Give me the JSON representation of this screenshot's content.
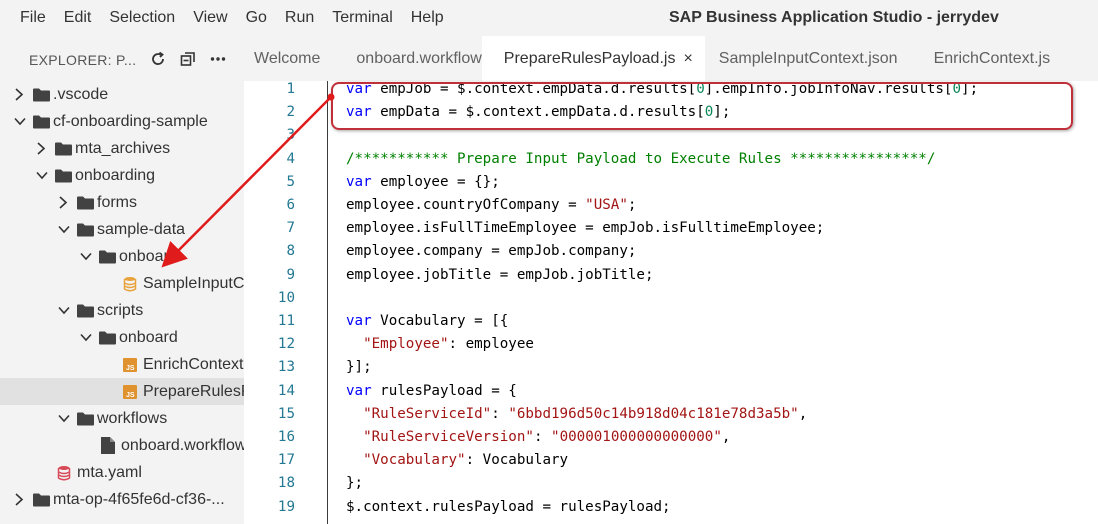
{
  "menu": [
    "File",
    "Edit",
    "Selection",
    "View",
    "Go",
    "Run",
    "Terminal",
    "Help"
  ],
  "window_title": "SAP Business Application Studio - jerrydev",
  "explorer": {
    "title": "EXPLORER: P...",
    "icons": [
      "refresh-icon",
      "collapse-all-icon",
      "more-icon"
    ]
  },
  "tree": [
    {
      "label": ".vscode",
      "icon": "folder-icon",
      "state": "collapsed"
    },
    {
      "label": "cf-onboarding-sample",
      "icon": "folder-icon",
      "state": "expanded"
    },
    {
      "label": "mta_archives",
      "icon": "folder-icon",
      "state": "collapsed"
    },
    {
      "label": "onboarding",
      "icon": "folder-icon",
      "state": "expanded"
    },
    {
      "label": "forms",
      "icon": "folder-icon",
      "state": "collapsed"
    },
    {
      "label": "sample-data",
      "icon": "folder-icon",
      "state": "expanded"
    },
    {
      "label": "onboard",
      "icon": "folder-icon",
      "state": "expanded"
    },
    {
      "label": "SampleInputCont...",
      "icon": "json-file-icon",
      "state": "file"
    },
    {
      "label": "scripts",
      "icon": "folder-icon",
      "state": "expanded"
    },
    {
      "label": "onboard",
      "icon": "folder-icon",
      "state": "expanded"
    },
    {
      "label": "EnrichContext.js",
      "icon": "js-file-icon",
      "state": "file"
    },
    {
      "label": "PrepareRulesPayl...",
      "icon": "js-file-icon",
      "state": "file",
      "selected": true
    },
    {
      "label": "workflows",
      "icon": "folder-icon",
      "state": "expanded"
    },
    {
      "label": "onboard.workflow",
      "icon": "file-icon",
      "state": "file"
    },
    {
      "label": "mta.yaml",
      "icon": "yaml-file-icon",
      "state": "file"
    },
    {
      "label": "mta-op-4f65fe6d-cf36-...",
      "icon": "folder-icon",
      "state": "collapsed"
    }
  ],
  "tabs": [
    {
      "label": "Welcome"
    },
    {
      "label": "onboard.workflow"
    },
    {
      "label": "PrepareRulesPayload.js",
      "active": true,
      "close": "×"
    },
    {
      "label": "SampleInputContext.json"
    },
    {
      "label": "EnrichContext.js"
    }
  ],
  "code_lines": [
    "var empJob = $.context.empData.d.results[0].empInfo.jobInfoNav.results[0];",
    "var empData = $.context.empData.d.results[0];",
    "",
    "/*********** Prepare Input Payload to Execute Rules ****************/",
    "var employee = {};",
    "employee.countryOfCompany = \"USA\";",
    "employee.isFullTimeEmployee = empJob.isFulltimeEmployee;",
    "employee.company = empJob.company;",
    "employee.jobTitle = empJob.jobTitle;",
    "",
    "var Vocabulary = [{",
    "  \"Employee\": employee",
    "}];",
    "var rulesPayload = {",
    "  \"RuleServiceId\": \"6bbd196d50c14b918d04c181e78d3a5b\",",
    "  \"RuleServiceVersion\": \"000001000000000000\",",
    "  \"Vocabulary\": Vocabulary",
    "};",
    "$.context.rulesPayload = rulesPayload;"
  ],
  "line_numbers": [
    "1",
    "2",
    "3",
    "4",
    "5",
    "6",
    "7",
    "8",
    "9",
    "10",
    "11",
    "12",
    "13",
    "14",
    "15",
    "16",
    "17",
    "18",
    "19"
  ],
  "colors": {
    "keyword": "#0000ff",
    "string": "#a31515",
    "number": "#098658",
    "comment": "#008000",
    "line_number": "#237893",
    "annotation": "#c0303a"
  }
}
